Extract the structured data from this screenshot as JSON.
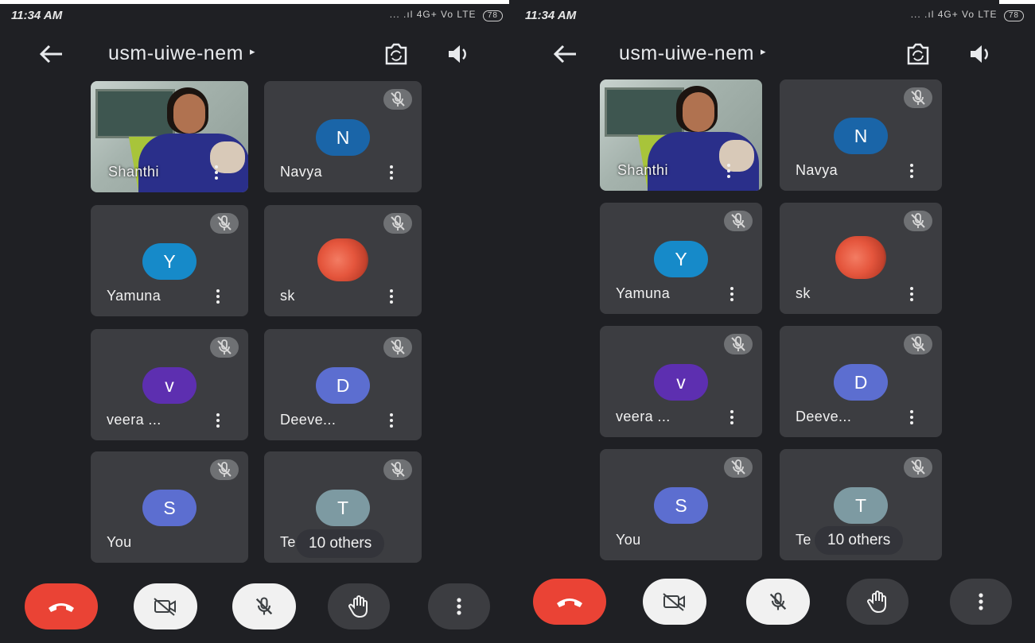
{
  "status_bar": {
    "time": "11:34 AM",
    "signal_text": "... .ıl 4G+ Vo LTE",
    "battery": "78"
  },
  "meeting": {
    "code": "usm-uiwe-nem",
    "caret": "▸"
  },
  "participants": [
    {
      "name": "Shanthi",
      "type": "video"
    },
    {
      "name": "Navya",
      "initial": "N",
      "color": "#1a65a8",
      "muted": true
    },
    {
      "name": "Yamuna",
      "initial": "Y",
      "color": "#168ac9",
      "muted": true
    },
    {
      "name": "sk",
      "type": "photo-avatar",
      "muted": true
    },
    {
      "name": "veera ...",
      "initial": "v",
      "color": "#5d2fb0",
      "muted": true
    },
    {
      "name": "Deeve...",
      "initial": "D",
      "color": "#5c6ed0",
      "muted": true
    },
    {
      "name": "You",
      "initial": "S",
      "color": "#5c6ed0",
      "muted": true
    },
    {
      "name": "Te",
      "initial": "T",
      "color": "#7d9aa2",
      "muted": true
    }
  ],
  "others_pill": "10 others",
  "controls": {
    "end_call": "end-call-icon",
    "camera": "camera-off-icon",
    "microphone": "mic-off-icon",
    "raise_hand": "hand-icon",
    "more": "more-vert-icon"
  },
  "colors": {
    "background": "#1f2024",
    "tile": "#3c3d41",
    "end_call": "#ea4335"
  }
}
